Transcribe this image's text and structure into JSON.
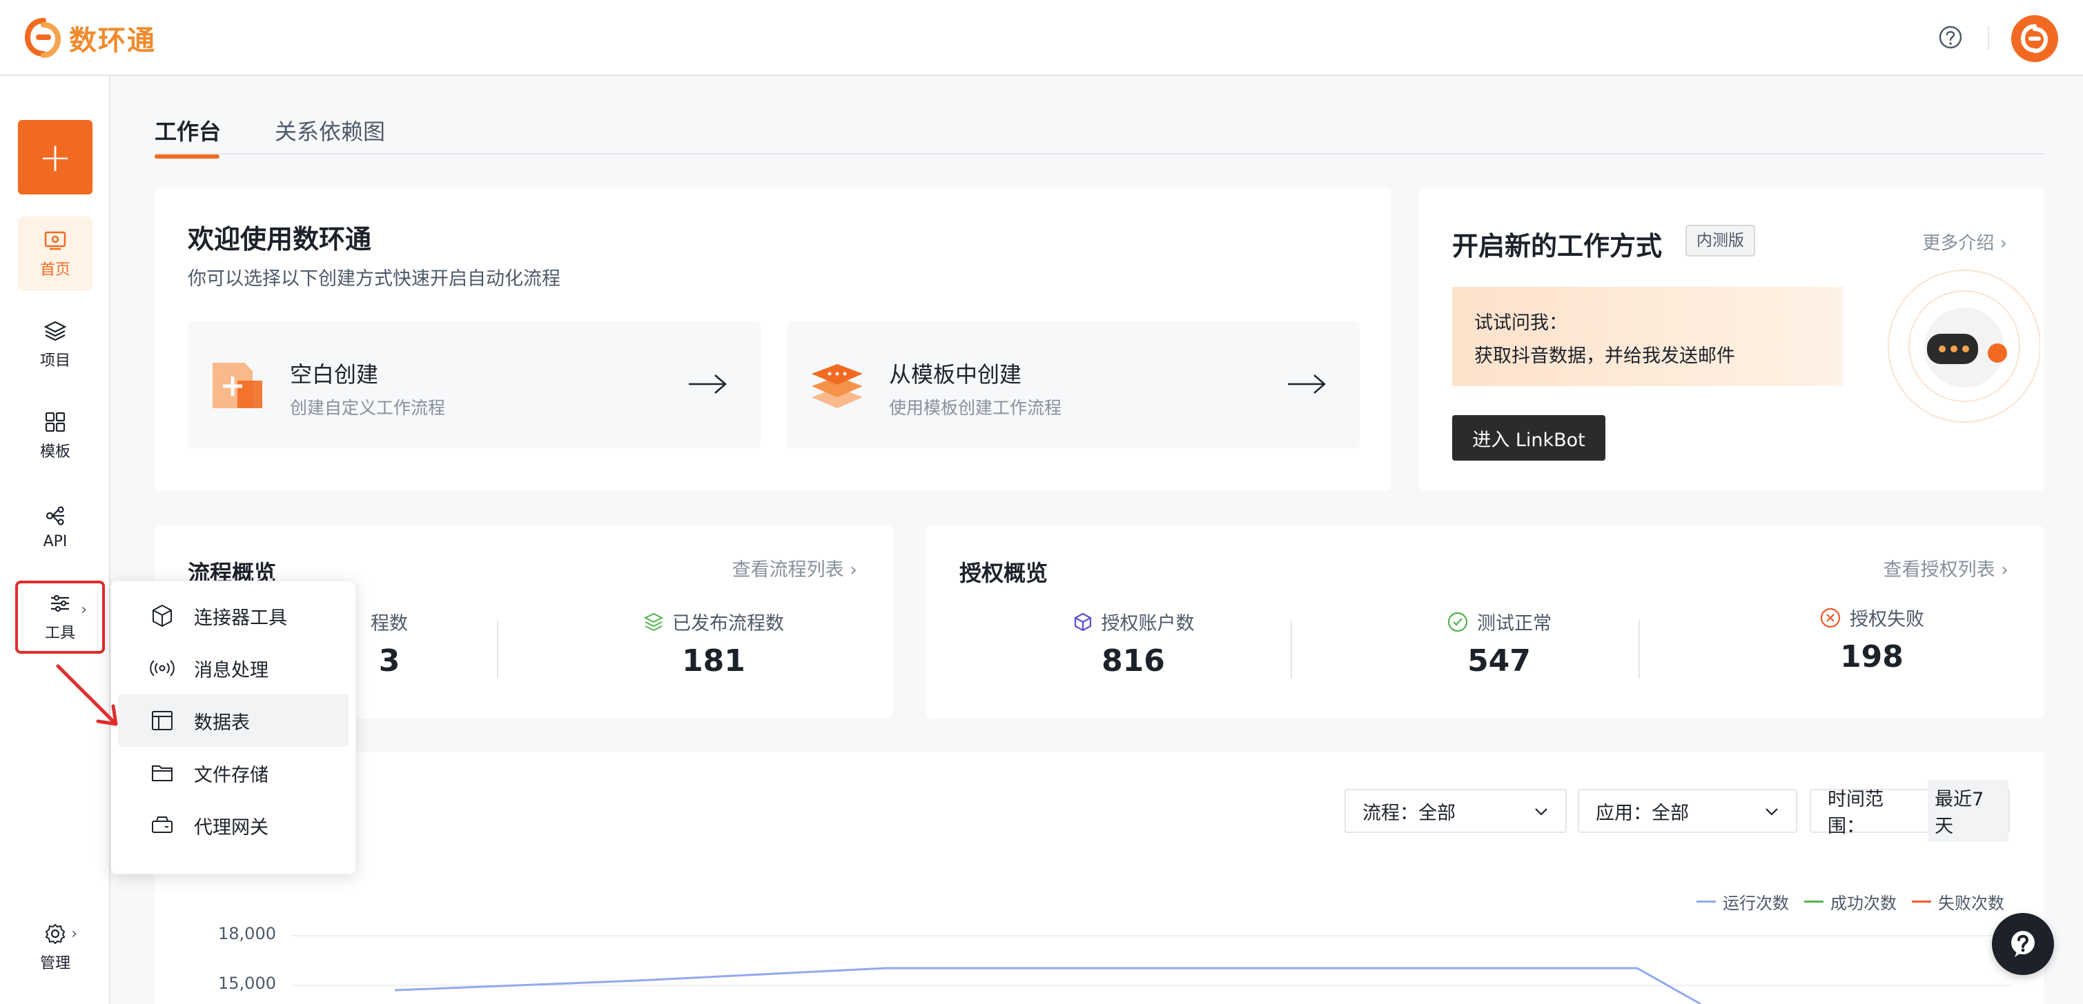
{
  "app": {
    "name": "数环通"
  },
  "sidebar": {
    "add_label": "+",
    "items": [
      {
        "label": "首页",
        "icon": "home-icon"
      },
      {
        "label": "项目",
        "icon": "layers-icon"
      },
      {
        "label": "模板",
        "icon": "grid-icon"
      },
      {
        "label": "API",
        "icon": "api-icon"
      },
      {
        "label": "工具",
        "icon": "sliders-icon"
      },
      {
        "label": "管理",
        "icon": "gear-icon"
      }
    ]
  },
  "tools_menu": {
    "items": [
      {
        "label": "连接器工具",
        "icon": "cube-icon"
      },
      {
        "label": "消息处理",
        "icon": "broadcast-icon"
      },
      {
        "label": "数据表",
        "icon": "table-icon"
      },
      {
        "label": "文件存储",
        "icon": "folder-icon"
      },
      {
        "label": "代理网关",
        "icon": "gateway-icon"
      }
    ]
  },
  "tabs": [
    {
      "label": "工作台"
    },
    {
      "label": "关系依赖图"
    }
  ],
  "welcome": {
    "title": "欢迎使用数环通",
    "subtitle": "你可以选择以下创建方式快速开启自动化流程",
    "blank": {
      "title": "空白创建",
      "subtitle": "创建自定义工作流程"
    },
    "template": {
      "title": "从模板中创建",
      "subtitle": "使用模板创建工作流程"
    }
  },
  "newway": {
    "title": "开启新的工作方式",
    "badge": "内测版",
    "more": "更多介绍",
    "try_line1": "试试问我：",
    "try_line2": "获取抖音数据，并给我发送邮件",
    "button": "进入 LinkBot"
  },
  "flow_overview": {
    "title": "流程概览",
    "link": "查看流程列表",
    "stats": [
      {
        "label": "程数",
        "value": "3"
      },
      {
        "label": "已发布流程数",
        "value": "181"
      }
    ]
  },
  "auth_overview": {
    "title": "授权概览",
    "link": "查看授权列表",
    "stats": [
      {
        "label": "授权账户数",
        "value": "816"
      },
      {
        "label": "测试正常",
        "value": "547"
      },
      {
        "label": "授权失败",
        "value": "198"
      }
    ]
  },
  "filters": {
    "flow": "流程：全部",
    "app": "应用：全部",
    "time_label": "时间范围：",
    "time_value": "最近7天"
  },
  "chart": {
    "legend": [
      {
        "name": "运行次数",
        "color": "#91a9f0"
      },
      {
        "name": "成功次数",
        "color": "#52b44b"
      },
      {
        "name": "失败次数",
        "color": "#f05a2c"
      }
    ],
    "yticks": [
      "18,000",
      "15,000"
    ]
  },
  "colors": {
    "accent": "#f26a21",
    "annotation": "#e02d2d"
  }
}
